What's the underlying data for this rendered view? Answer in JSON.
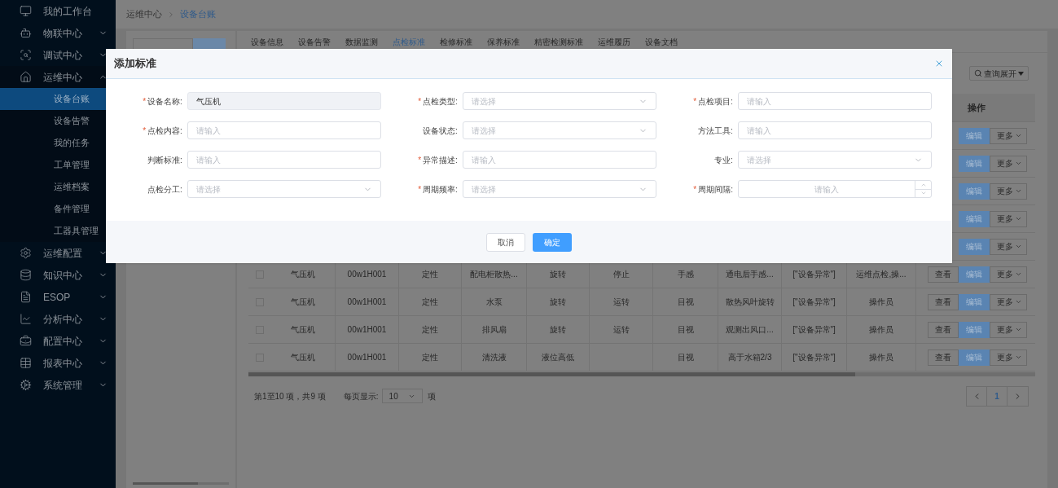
{
  "sidebar": {
    "items": [
      {
        "label": "我的工作台"
      },
      {
        "label": "物联中心",
        "expanded": false
      },
      {
        "label": "调试中心",
        "expanded": false
      },
      {
        "label": "运维中心",
        "expanded": true,
        "children": [
          {
            "label": "设备台账",
            "selected": true
          },
          {
            "label": "设备告警",
            "selected": false
          },
          {
            "label": "我的任务",
            "selected": false
          },
          {
            "label": "工单管理",
            "selected": false
          },
          {
            "label": "运维档案",
            "selected": false
          },
          {
            "label": "备件管理",
            "selected": false
          },
          {
            "label": "工器具管理",
            "selected": false
          }
        ]
      },
      {
        "label": "运维配置",
        "expanded": false
      },
      {
        "label": "知识中心",
        "expanded": false
      },
      {
        "label": "ESOP",
        "expanded": false
      },
      {
        "label": "分析中心",
        "expanded": false
      },
      {
        "label": "配置中心",
        "expanded": false
      },
      {
        "label": "报表中心",
        "expanded": false
      },
      {
        "label": "系统管理",
        "expanded": false
      }
    ]
  },
  "breadcrumb": [
    "运维中心",
    "设备台账"
  ],
  "tabs": [
    {
      "label": "设备信息",
      "selected": false
    },
    {
      "label": "设备告警",
      "selected": false
    },
    {
      "label": "数据监测",
      "selected": false
    },
    {
      "label": "点检标准",
      "selected": true
    },
    {
      "label": "检修标准",
      "selected": false
    },
    {
      "label": "保养标准",
      "selected": false
    },
    {
      "label": "精密检测标准",
      "selected": false
    },
    {
      "label": "运维履历",
      "selected": false
    },
    {
      "label": "设备文档",
      "selected": false
    }
  ],
  "query_toggle": "查询展开",
  "table": {
    "action_header": "操作",
    "rows": [
      {
        "actions": [
          {
            "label": "编辑",
            "kind": "primary"
          },
          {
            "label": "更多",
            "kind": "dropdown"
          }
        ]
      },
      {
        "actions": [
          {
            "label": "编辑",
            "kind": "primary"
          },
          {
            "label": "更多",
            "kind": "dropdown"
          }
        ]
      },
      {
        "actions": [
          {
            "label": "编辑",
            "kind": "primary"
          },
          {
            "label": "更多",
            "kind": "dropdown"
          }
        ]
      },
      {
        "actions": [
          {
            "label": "编辑",
            "kind": "primary"
          },
          {
            "label": "更多",
            "kind": "dropdown"
          }
        ]
      },
      {
        "actions": [
          {
            "label": "编辑",
            "kind": "primary"
          },
          {
            "label": "更多",
            "kind": "dropdown"
          }
        ]
      },
      {
        "checked": false,
        "cells": [
          "气压机",
          "00w1H001",
          "定性",
          "配电柜散热...",
          "旋转",
          "停止",
          "手感",
          "通电后手感...",
          "[\"设备异常\"]",
          "运维点检,操..."
        ],
        "actions": [
          {
            "label": "查看",
            "kind": "default"
          },
          {
            "label": "编辑",
            "kind": "primary"
          },
          {
            "label": "更多",
            "kind": "dropdown"
          }
        ]
      },
      {
        "checked": false,
        "cells": [
          "气压机",
          "00w1H001",
          "定性",
          "水泵",
          "旋转",
          "运转",
          "目视",
          "散热风叶旋转",
          "[\"设备异常\"]",
          "操作员"
        ],
        "actions": [
          {
            "label": "查看",
            "kind": "default"
          },
          {
            "label": "编辑",
            "kind": "primary"
          },
          {
            "label": "更多",
            "kind": "dropdown"
          }
        ]
      },
      {
        "checked": false,
        "cells": [
          "气压机",
          "00w1H001",
          "定性",
          "排风扇",
          "旋转",
          "运转",
          "目视",
          "观测出风口...",
          "[\"设备异常\"]",
          "操作员"
        ],
        "actions": [
          {
            "label": "查看",
            "kind": "default"
          },
          {
            "label": "编辑",
            "kind": "primary"
          },
          {
            "label": "更多",
            "kind": "dropdown"
          }
        ]
      },
      {
        "checked": false,
        "cells": [
          "气压机",
          "00w1H001",
          "定性",
          "清洗液",
          "液位高低",
          null,
          "目视",
          "高于水箱2/3",
          "[\"设备异常\"]",
          "操作员"
        ],
        "actions": [
          {
            "label": "查看",
            "kind": "default"
          },
          {
            "label": "编辑",
            "kind": "primary"
          },
          {
            "label": "更多",
            "kind": "dropdown"
          }
        ]
      }
    ]
  },
  "pagination": {
    "summary": "第1至10 项，共9 项",
    "page_size_label": "每页显示:",
    "page_size": "10",
    "page_size_unit": "项",
    "pages": [
      {
        "label": "1",
        "selected": true
      }
    ]
  },
  "dialog": {
    "title": "添加标准",
    "fields": [
      {
        "required_mark": "*",
        "label": "设备名称:",
        "kind": "readonly",
        "value": "气压机"
      },
      {
        "required_mark": "*",
        "label": "点检类型:",
        "kind": "select",
        "placeholder": "请选择"
      },
      {
        "required_mark": "*",
        "label": "点检项目:",
        "kind": "input",
        "placeholder": "请输入"
      },
      {
        "required_mark": "*",
        "label": "点检内容:",
        "kind": "input",
        "placeholder": "请输入"
      },
      {
        "label": "设备状态:",
        "kind": "select",
        "placeholder": "请选择"
      },
      {
        "label": "方法工具:",
        "kind": "input",
        "placeholder": "请输入"
      },
      {
        "label": "判断标准:",
        "kind": "input",
        "placeholder": "请输入"
      },
      {
        "required_mark": "*",
        "label": "异常描述:",
        "kind": "input",
        "placeholder": "请输入"
      },
      {
        "label": "专业:",
        "kind": "select",
        "placeholder": "请选择"
      },
      {
        "label": "点检分工:",
        "kind": "select",
        "placeholder": "请选择"
      },
      {
        "required_mark": "*",
        "label": "周期频率:",
        "kind": "select",
        "placeholder": "请选择"
      },
      {
        "required_mark": "*",
        "label": "周期间隔:",
        "kind": "number",
        "placeholder": "请输入"
      }
    ],
    "buttons": [
      {
        "label": "取消",
        "kind": "default"
      },
      {
        "label": "确定",
        "kind": "primary"
      }
    ]
  }
}
